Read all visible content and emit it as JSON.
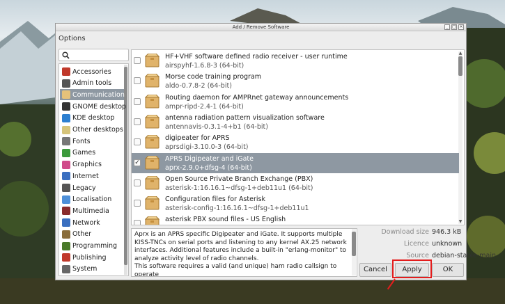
{
  "window": {
    "title": "Add / Remove Software",
    "controls": [
      "_",
      "□",
      "×"
    ]
  },
  "menu": {
    "options": "Options"
  },
  "search": {
    "value": "",
    "placeholder": ""
  },
  "categories": [
    {
      "label": "Accessories",
      "icon": "accessories-icon",
      "color": "#c0392b"
    },
    {
      "label": "Admin tools",
      "icon": "admin-tools-icon",
      "color": "#555555"
    },
    {
      "label": "Communication",
      "icon": "communication-icon",
      "color": "#e6c27a",
      "selected": true
    },
    {
      "label": "GNOME desktop",
      "icon": "gnome-icon",
      "color": "#333333"
    },
    {
      "label": "KDE desktop",
      "icon": "kde-icon",
      "color": "#2d7fd0"
    },
    {
      "label": "Other desktops",
      "icon": "other-desktops-icon",
      "color": "#d6c47a"
    },
    {
      "label": "Fonts",
      "icon": "fonts-icon",
      "color": "#777777"
    },
    {
      "label": "Games",
      "icon": "games-icon",
      "color": "#3c9a3c"
    },
    {
      "label": "Graphics",
      "icon": "graphics-icon",
      "color": "#d04a8a"
    },
    {
      "label": "Internet",
      "icon": "internet-icon",
      "color": "#3a6fc0"
    },
    {
      "label": "Legacy",
      "icon": "legacy-icon",
      "color": "#555555"
    },
    {
      "label": "Localisation",
      "icon": "localisation-icon",
      "color": "#4d8fd8"
    },
    {
      "label": "Multimedia",
      "icon": "multimedia-icon",
      "color": "#8a2b2b"
    },
    {
      "label": "Network",
      "icon": "network-icon",
      "color": "#3a6fc0"
    },
    {
      "label": "Other",
      "icon": "other-icon",
      "color": "#8a6d3b"
    },
    {
      "label": "Programming",
      "icon": "programming-icon",
      "color": "#4a7a2a"
    },
    {
      "label": "Publishing",
      "icon": "publishing-icon",
      "color": "#c0392b"
    },
    {
      "label": "System",
      "icon": "system-icon",
      "color": "#666666"
    }
  ],
  "packages": [
    {
      "title": "HF+VHF software defined radio receiver - user runtime",
      "name": "airspyhf-1.6.8-3 (64-bit)",
      "checked": false
    },
    {
      "title": "Morse code training program",
      "name": "aldo-0.7.8-2 (64-bit)",
      "checked": false
    },
    {
      "title": "Routing daemon for AMPRnet gateway announcements",
      "name": "ampr-ripd-2.4-1 (64-bit)",
      "checked": false
    },
    {
      "title": "antenna radiation pattern visualization software",
      "name": "antennavis-0.3.1-4+b1 (64-bit)",
      "checked": false
    },
    {
      "title": "digipeater for APRS",
      "name": "aprsdigi-3.10.0-3 (64-bit)",
      "checked": false
    },
    {
      "title": "APRS Digipeater and iGate",
      "name": "aprx-2.9.0+dfsg-4 (64-bit)",
      "checked": true,
      "selected": true
    },
    {
      "title": "Open Source Private Branch Exchange (PBX)",
      "name": "asterisk-1:16.16.1~dfsg-1+deb11u1 (64-bit)",
      "checked": false
    },
    {
      "title": "Configuration files for Asterisk",
      "name": "asterisk-config-1:16.16.1~dfsg-1+deb11u1",
      "checked": false
    },
    {
      "title": "asterisk PBX sound files - US English",
      "name": "",
      "checked": false
    }
  ],
  "description": "Aprx is an APRS specific Digipeater and iGate. It supports multiple KISS-TNCs on serial ports  and listening to any kernel AX.25 network interfaces. Additional features include a built-in \"erlang-monitor\" to analyze activity level of radio channels.\nThis software requires a valid (and unique) ham radio callsign to operate",
  "info": {
    "download_size_label": "Download size",
    "download_size": "946.3 kB",
    "licence_label": "Licence",
    "licence": "unknown",
    "source_label": "Source",
    "source": "debian-stable-main"
  },
  "buttons": {
    "cancel": "Cancel",
    "apply": "Apply",
    "ok": "OK"
  },
  "colors": {
    "selection": "#8e98a2",
    "highlight": "#e31d1d"
  }
}
